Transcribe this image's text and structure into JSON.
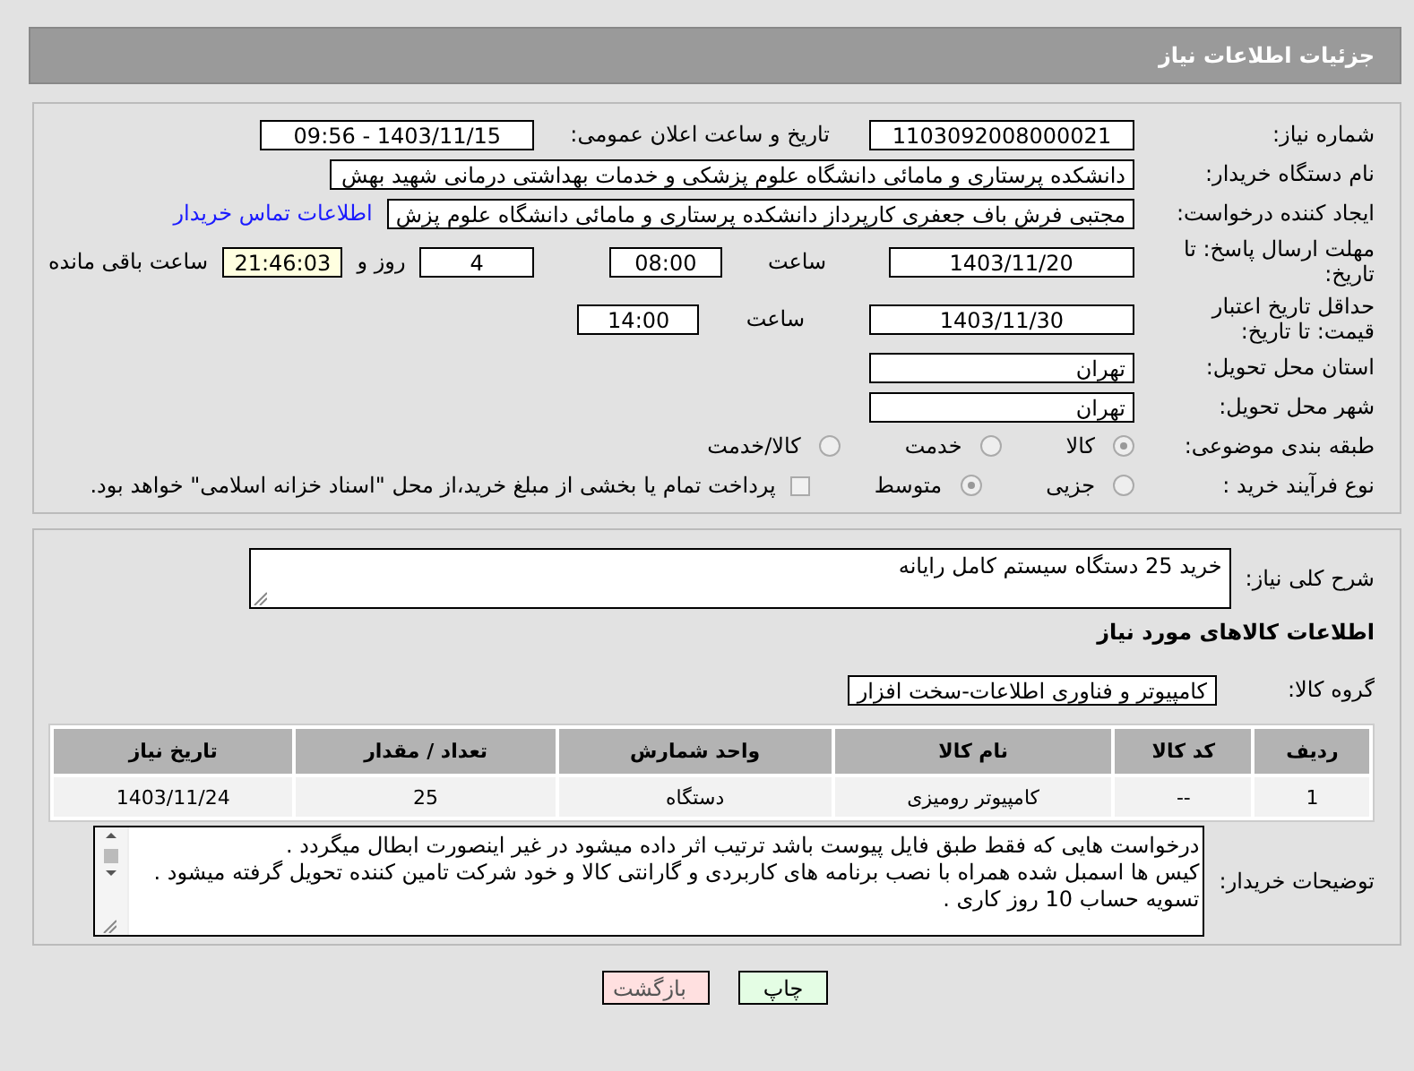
{
  "header": {
    "title": "جزئیات اطلاعات نیاز"
  },
  "need_number": {
    "label": "شماره نیاز:",
    "value": "1103092008000021"
  },
  "announce_datetime": {
    "label": "تاریخ و ساعت اعلان عمومی:",
    "value": "1403/11/15 - 09:56"
  },
  "buyer_org": {
    "label": "نام دستگاه خریدار:",
    "value": "دانشکده پرستاری و مامائی دانشگاه علوم پزشکی و خدمات بهداشتی درمانی شهید بهش"
  },
  "requester": {
    "label": "ایجاد کننده درخواست:",
    "value": "مجتبی فرش باف جعفری کارپرداز دانشکده پرستاری و مامائی دانشگاه علوم پزش",
    "link": "اطلاعات تماس خریدار"
  },
  "response_deadline": {
    "label": "مهلت ارسال پاسخ: تا تاریخ:",
    "date": "1403/11/20",
    "time_label": "ساعت",
    "time": "08:00",
    "days": "4",
    "days_label": "روز و",
    "remaining": "21:46:03",
    "remaining_label": "ساعت باقی مانده"
  },
  "price_validity": {
    "label": "حداقل تاریخ اعتبار قیمت: تا تاریخ:",
    "date": "1403/11/30",
    "time_label": "ساعت",
    "time": "14:00"
  },
  "province": {
    "label": "استان محل تحویل:",
    "value": "تهران"
  },
  "city": {
    "label": "شهر محل تحویل:",
    "value": "تهران"
  },
  "category": {
    "label": "طبقه بندی موضوعی:",
    "options": [
      {
        "label": "کالا",
        "selected": true
      },
      {
        "label": "خدمت",
        "selected": false
      },
      {
        "label": "کالا/خدمت",
        "selected": false
      }
    ]
  },
  "process": {
    "label": "نوع فرآیند خرید :",
    "options": [
      {
        "label": "جزیی",
        "selected": false
      },
      {
        "label": "متوسط",
        "selected": true
      }
    ],
    "treasury": {
      "label": "پرداخت تمام یا بخشی از مبلغ خرید،از محل \"اسناد خزانه اسلامی\" خواهد بود.",
      "checked": false
    }
  },
  "description": {
    "label": "شرح کلی نیاز:",
    "value": "خرید 25 دستگاه سیستم کامل رایانه"
  },
  "goods_heading": "اطلاعات کالاهای مورد نیاز",
  "goods_group": {
    "label": "گروه کالا:",
    "value": "کامپیوتر و فناوری اطلاعات-سخت افزار"
  },
  "table": {
    "columns": [
      "ردیف",
      "کد کالا",
      "نام کالا",
      "واحد شمارش",
      "تعداد / مقدار",
      "تاریخ نیاز"
    ],
    "rows": [
      [
        "1",
        "--",
        "کامپیوتر رومیزی",
        "دستگاه",
        "25",
        "1403/11/24"
      ]
    ]
  },
  "buyer_notes": {
    "label": "توضیحات خریدار:",
    "lines": [
      "درخواست هایی که فقط طبق فایل پیوست باشد ترتیب اثر داده میشود در غیر اینصورت ابطال میگردد .",
      "کیس ها اسمبل شده همراه با نصب برنامه های کاربردی و گارانتی کالا و خود شرکت تامین کننده تحویل گرفته میشود .",
      "تسویه حساب 10 روز کاری ."
    ]
  },
  "buttons": [
    {
      "label": "چاپ",
      "kind": "print"
    },
    {
      "label": "بازگشت",
      "kind": "back"
    }
  ]
}
